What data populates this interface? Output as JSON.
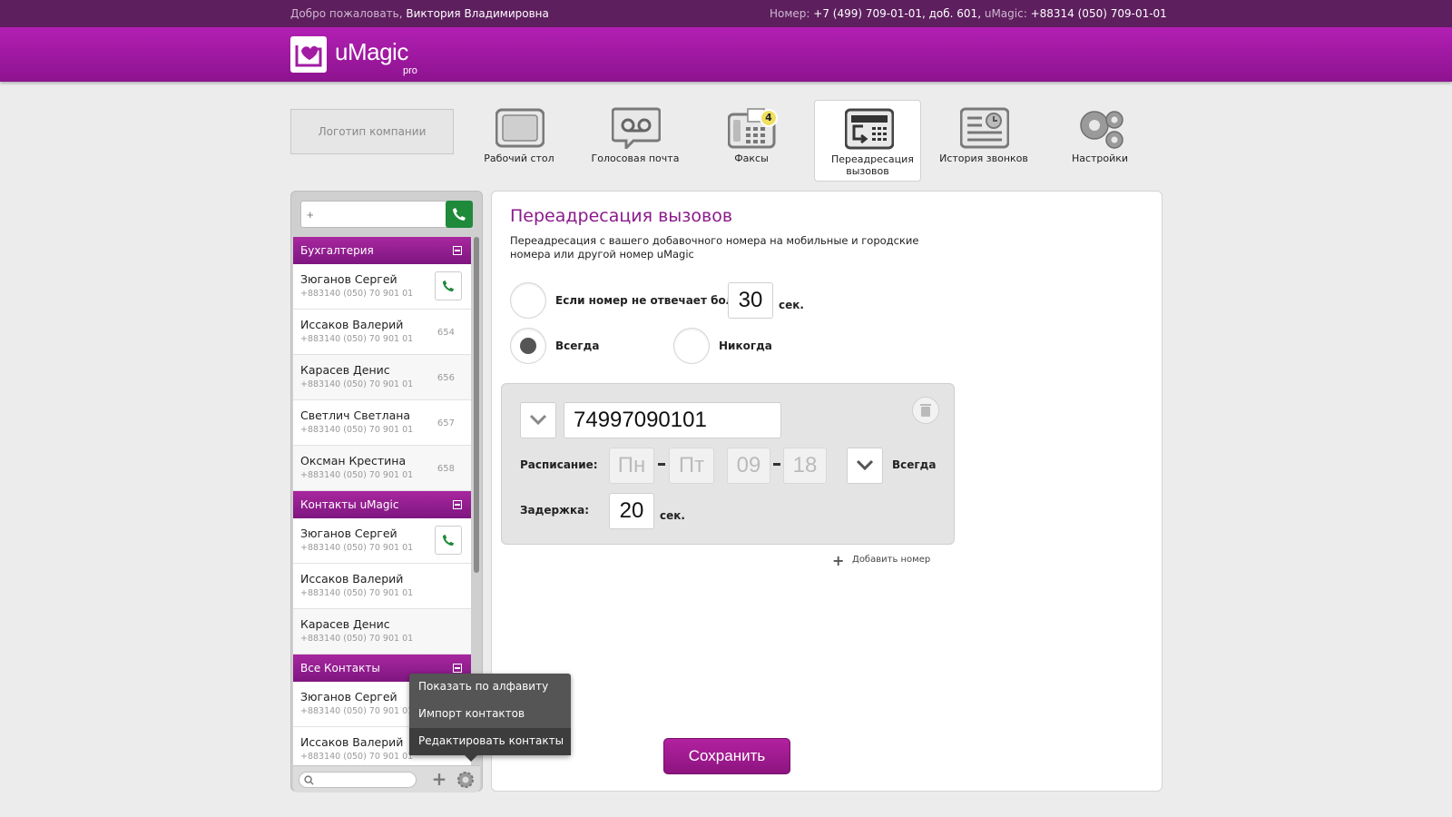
{
  "topbar": {
    "welcome_prefix": "Добро пожаловать,",
    "user_name": "Виктория Владимировна",
    "number_label": "Номер:",
    "number_value": "+7 (499) 709-01-01, доб. 601,",
    "umagic_label": "uMagic:",
    "umagic_value": "+88314 (050) 709-01-01"
  },
  "brand": {
    "name": "uMagic",
    "suffix": "pro"
  },
  "company_logo_placeholder": "Логотип компании",
  "nav": [
    {
      "label": "Рабочий стол",
      "icon": "desktop-icon"
    },
    {
      "label": "Голосовая почта",
      "icon": "voicemail-icon"
    },
    {
      "label": "Факсы",
      "icon": "fax-icon",
      "badge": "4"
    },
    {
      "label": "Переадресация вызовов",
      "icon": "call-forward-icon",
      "active": true
    },
    {
      "label": "История звонков",
      "icon": "call-history-icon"
    },
    {
      "label": "Настройки",
      "icon": "settings-icon"
    }
  ],
  "sidebar": {
    "dial_placeholder": "+",
    "groups": [
      {
        "name": "Бухгалтерия",
        "contacts": [
          {
            "name": "Зюганов Сергей",
            "phone": "+883140 (050) 70 901 01",
            "ext": ""
          },
          {
            "name": "Иссаков Валерий",
            "phone": "+883140 (050) 70 901 01",
            "ext": "654"
          },
          {
            "name": "Карасев Денис",
            "phone": "+883140 (050) 70 901 01",
            "ext": "656"
          },
          {
            "name": "Светлич Светлана",
            "phone": "+883140 (050) 70 901 01",
            "ext": "657"
          },
          {
            "name": "Оксман Крестина",
            "phone": "+883140 (050) 70 901 01",
            "ext": "658"
          }
        ]
      },
      {
        "name": "Контакты uMagic",
        "contacts": [
          {
            "name": "Зюганов Сергей",
            "phone": "+883140 (050) 70 901 01",
            "ext": ""
          },
          {
            "name": "Иссаков Валерий",
            "phone": "+883140 (050) 70 901 01",
            "ext": ""
          },
          {
            "name": "Карасев Денис",
            "phone": "+883140 (050) 70 901 01",
            "ext": ""
          }
        ]
      },
      {
        "name": "Все Контакты",
        "contacts": [
          {
            "name": "Зюганов Сергей",
            "phone": "+883140 (050) 70 901 01",
            "ext": ""
          },
          {
            "name": "Иссаков Валерий",
            "phone": "+883140 (050) 70 901 01",
            "ext": ""
          }
        ]
      }
    ],
    "search_value": ""
  },
  "context_menu": [
    "Показать по алфавиту",
    "Импорт контактов",
    "Редактировать контакты"
  ],
  "main": {
    "title": "Переадресация вызовов",
    "description": "Переадресация с вашего добавочного номера на мобильные и городские номера или другой номер uMagic",
    "opt_noanswer": "Если номер не отвечает более",
    "noanswer_value": "30",
    "sec": "сек.",
    "opt_always": "Всегда",
    "opt_never": "Никогда",
    "forward_number": "74997090101",
    "schedule_label": "Расписание:",
    "day_from": "Пн",
    "day_to": "Пт",
    "hour_from": "09",
    "hour_to": "18",
    "schedule_mode": "Всегда",
    "delay_label": "Задержка:",
    "delay_value": "20",
    "add_number": "Добавить номер",
    "save": "Сохранить"
  },
  "colors": {
    "brand": "#a11ba3",
    "topbar": "#5d1f5e",
    "call_green": "#1e8a3a"
  }
}
